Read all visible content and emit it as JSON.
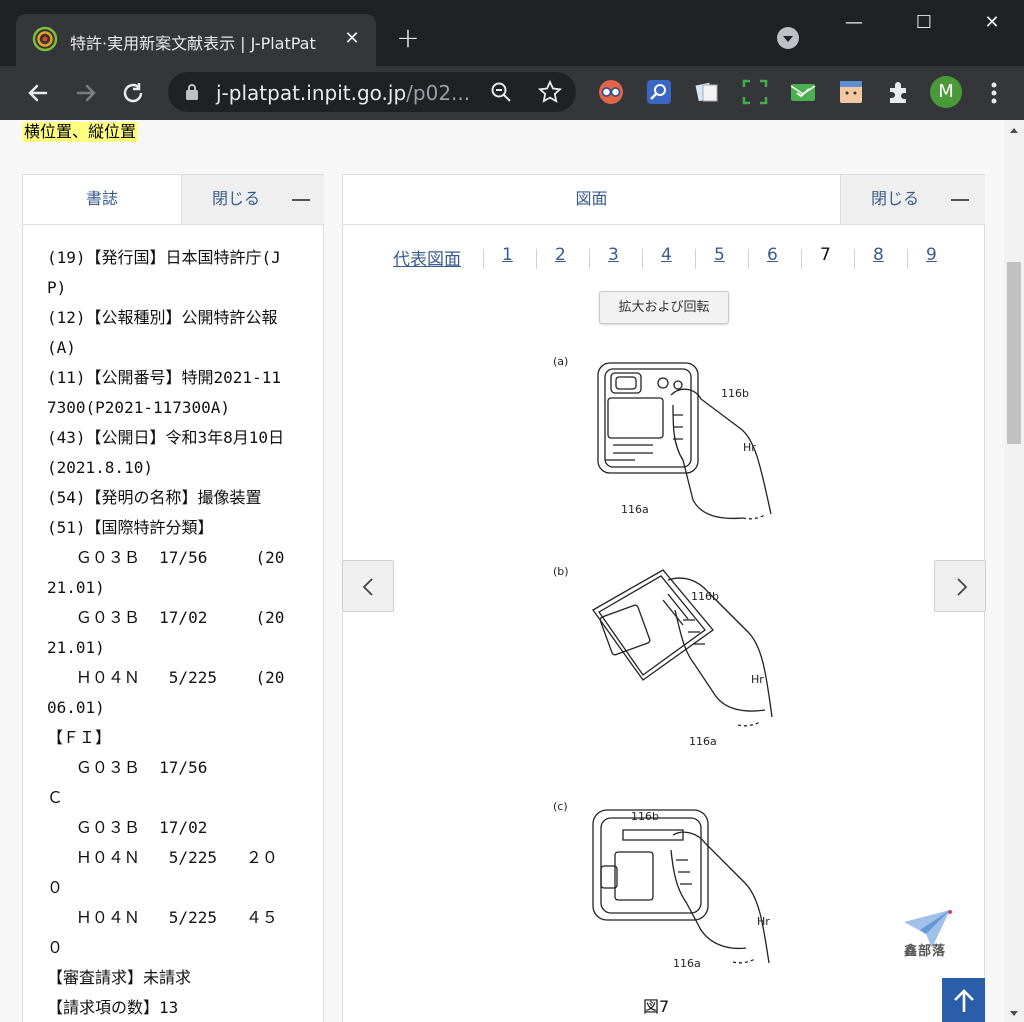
{
  "browser": {
    "tab_title": "特許·実用新案文献表示 | J-PlatPat",
    "tab_close": "✕",
    "new_tab": "+",
    "url_host": "j-platpat.inpit.go.jp",
    "url_path": "/p02...",
    "avatar_letter": "M",
    "window_minimize": "—",
    "window_maximize": "☐",
    "window_close": "✕"
  },
  "page": {
    "highlight_text": "横位置、縦位置"
  },
  "left_panel": {
    "tab_label": "書誌",
    "close_label": "閉じる",
    "lines": [
      "(19)【発行国】日本国特許庁(J",
      "P)",
      "(12)【公報種別】公開特許公報",
      "(A)",
      "(11)【公開番号】特開2021-11",
      "7300(P2021-117300A)",
      "(43)【公開日】令和3年8月10日",
      "(2021.8.10)",
      "(54)【発明の名称】撮像装置",
      "(51)【国際特許分類】",
      "   Ｇ０３Ｂ  17/56     (20",
      "21.01)",
      "   Ｇ０３Ｂ  17/02     (20",
      "21.01)",
      "   Ｈ０４Ｎ   5/225    (20",
      "06.01)",
      "【ＦＩ】",
      "   Ｇ０３Ｂ  17/56",
      "Ｃ",
      "   Ｇ０３Ｂ  17/02",
      "   Ｈ０４Ｎ   5/225   ２０",
      "０",
      "   Ｈ０４Ｎ   5/225   ４５",
      "０",
      "【審査請求】未請求",
      "【請求項の数】13"
    ]
  },
  "right_panel": {
    "tab_label": "図面",
    "close_label": "閉じる",
    "figure_links": [
      "代表図面",
      "1",
      "2",
      "3",
      "4",
      "5",
      "6",
      "7",
      "8",
      "9"
    ],
    "current_figure": "7",
    "zoom_button": "拡大および回転",
    "prev_arrow": "‹",
    "next_arrow": "›",
    "drawing_labels": {
      "a": "(a)",
      "b": "(b)",
      "c": "(c)",
      "grip": "116b",
      "hand": "Hr",
      "body": "116a"
    },
    "figure_caption": "図7"
  },
  "watermark": "鑫部落",
  "back_to_top": "↑",
  "colors": {
    "link": "#3a5b8c",
    "highlight": "#ffff80",
    "back_to_top": "#2a5ea8",
    "chrome_dark": "#202124",
    "chrome_mid": "#35363a"
  }
}
